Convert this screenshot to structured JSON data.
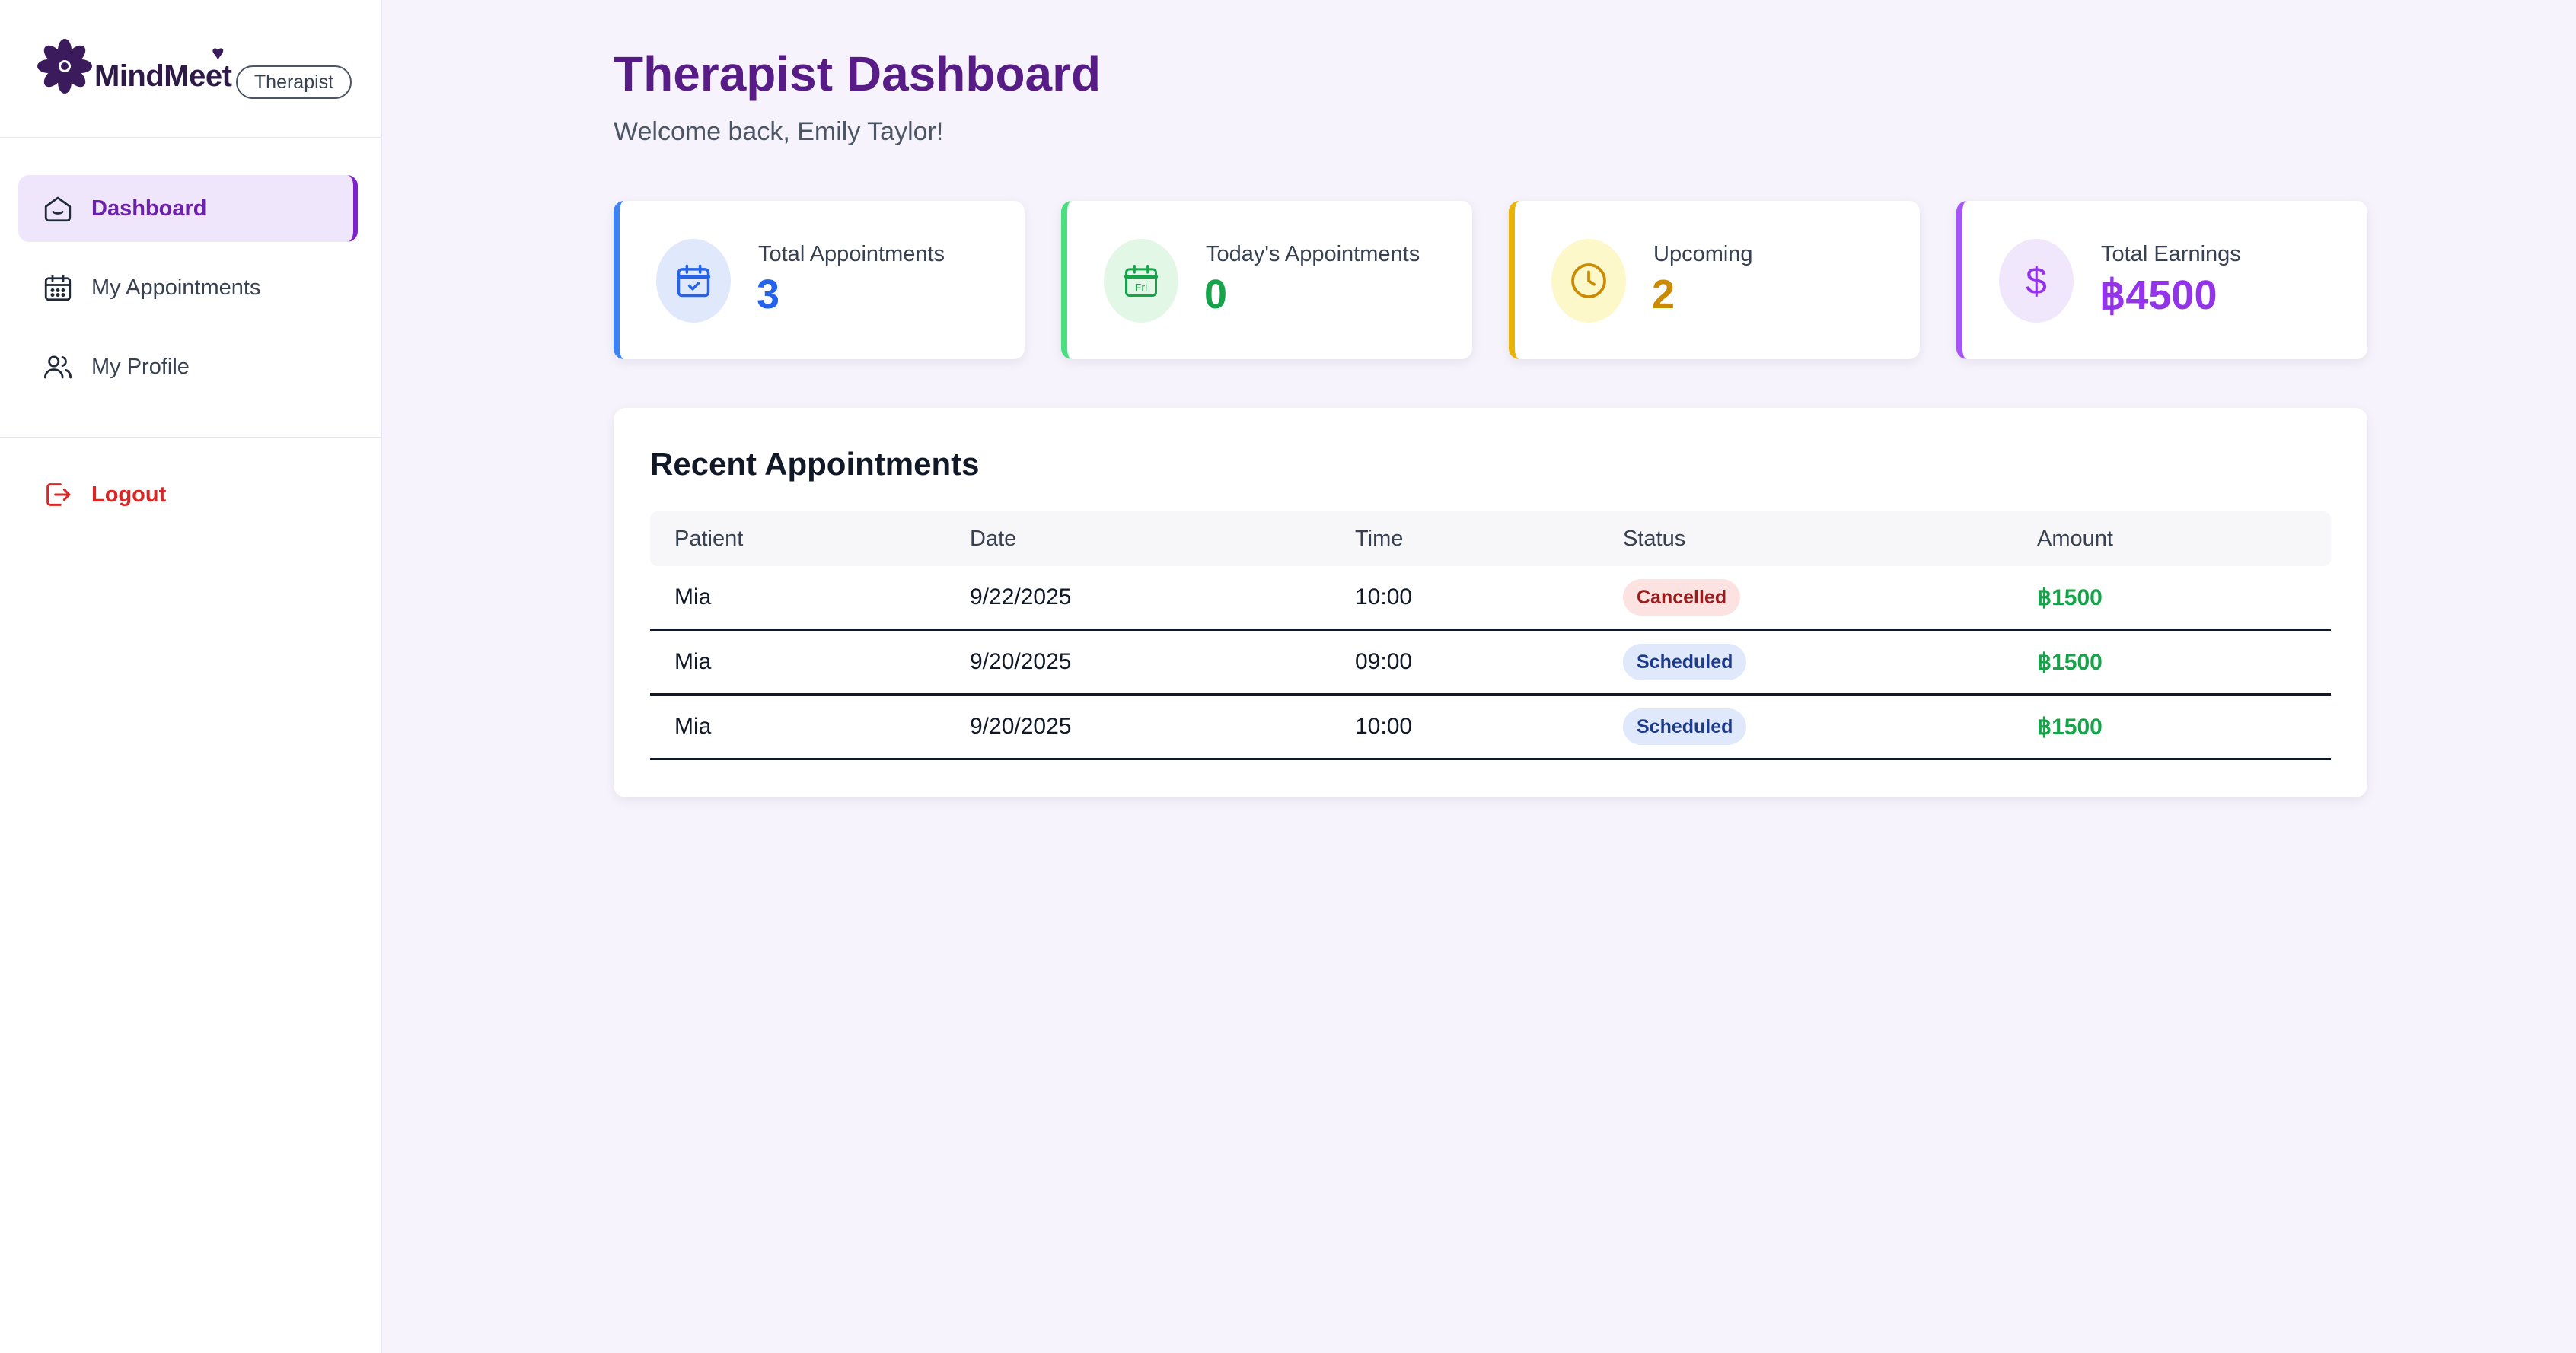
{
  "brand": {
    "name": "MindMeet",
    "role": "Therapist"
  },
  "sidebar": {
    "items": [
      {
        "label": "Dashboard",
        "icon": "home-icon",
        "active": true
      },
      {
        "label": "My Appointments",
        "icon": "calendar-icon",
        "active": false
      },
      {
        "label": "My Profile",
        "icon": "users-icon",
        "active": false
      }
    ],
    "logout_label": "Logout"
  },
  "header": {
    "title": "Therapist Dashboard",
    "welcome": "Welcome back, Emily Taylor!"
  },
  "stats": [
    {
      "label": "Total Appointments",
      "value": "3",
      "icon": "calendar-check-icon",
      "color": "#2563eb",
      "accent": "#3b82f6",
      "icon_bg": "#e0e9fb"
    },
    {
      "label": "Today's Appointments",
      "value": "0",
      "icon": "calendar-fri-icon",
      "icon_text": "Fri",
      "color": "#16a34a",
      "accent": "#4ade80",
      "icon_bg": "#e3f7e6"
    },
    {
      "label": "Upcoming",
      "value": "2",
      "icon": "clock-icon",
      "color": "#ca8a04",
      "accent": "#eab308",
      "icon_bg": "#fdf8c9"
    },
    {
      "label": "Total Earnings",
      "value": "฿4500",
      "icon": "dollar-icon",
      "icon_text": "$",
      "color": "#9333ea",
      "accent": "#a855f7",
      "icon_bg": "#f1e7fc"
    }
  ],
  "recent": {
    "title": "Recent Appointments",
    "columns": [
      "Patient",
      "Date",
      "Time",
      "Status",
      "Amount"
    ],
    "rows": [
      {
        "patient": "Mia",
        "date": "9/22/2025",
        "time": "10:00",
        "status": "Cancelled",
        "amount": "฿1500"
      },
      {
        "patient": "Mia",
        "date": "9/20/2025",
        "time": "09:00",
        "status": "Scheduled",
        "amount": "฿1500"
      },
      {
        "patient": "Mia",
        "date": "9/20/2025",
        "time": "10:00",
        "status": "Scheduled",
        "amount": "฿1500"
      }
    ]
  }
}
